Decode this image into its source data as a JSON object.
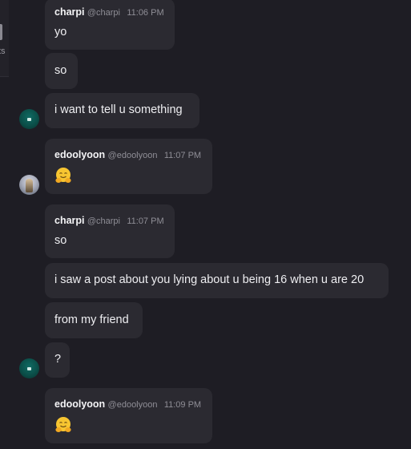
{
  "left_panel": {
    "fragment_text": "ts"
  },
  "colors": {
    "background": "#1e1d24",
    "bubble": "#2b2a31",
    "text": "#eeeef1",
    "muted": "#8f8e96"
  },
  "messages": [
    {
      "author": "charpi",
      "handle": "@charpi",
      "time": "11:06 PM",
      "text": "yo"
    },
    {
      "text": "so"
    },
    {
      "text": "i want to tell u something",
      "avatar": "charpi-avatar"
    },
    {
      "author": "edoolyoon",
      "handle": "@edoolyoon",
      "time": "11:07 PM",
      "emoji": "hugging-face-emoji",
      "avatar": "edoolyoon-avatar"
    },
    {
      "author": "charpi",
      "handle": "@charpi",
      "time": "11:07 PM",
      "text": "so"
    },
    {
      "text": "i saw a post about you lying about u being 16 when u are 20"
    },
    {
      "text": "from my friend"
    },
    {
      "text": "?",
      "avatar": "charpi-avatar"
    },
    {
      "author": "edoolyoon",
      "handle": "@edoolyoon",
      "time": "11:09 PM",
      "emoji": "hugging-face-emoji"
    }
  ]
}
